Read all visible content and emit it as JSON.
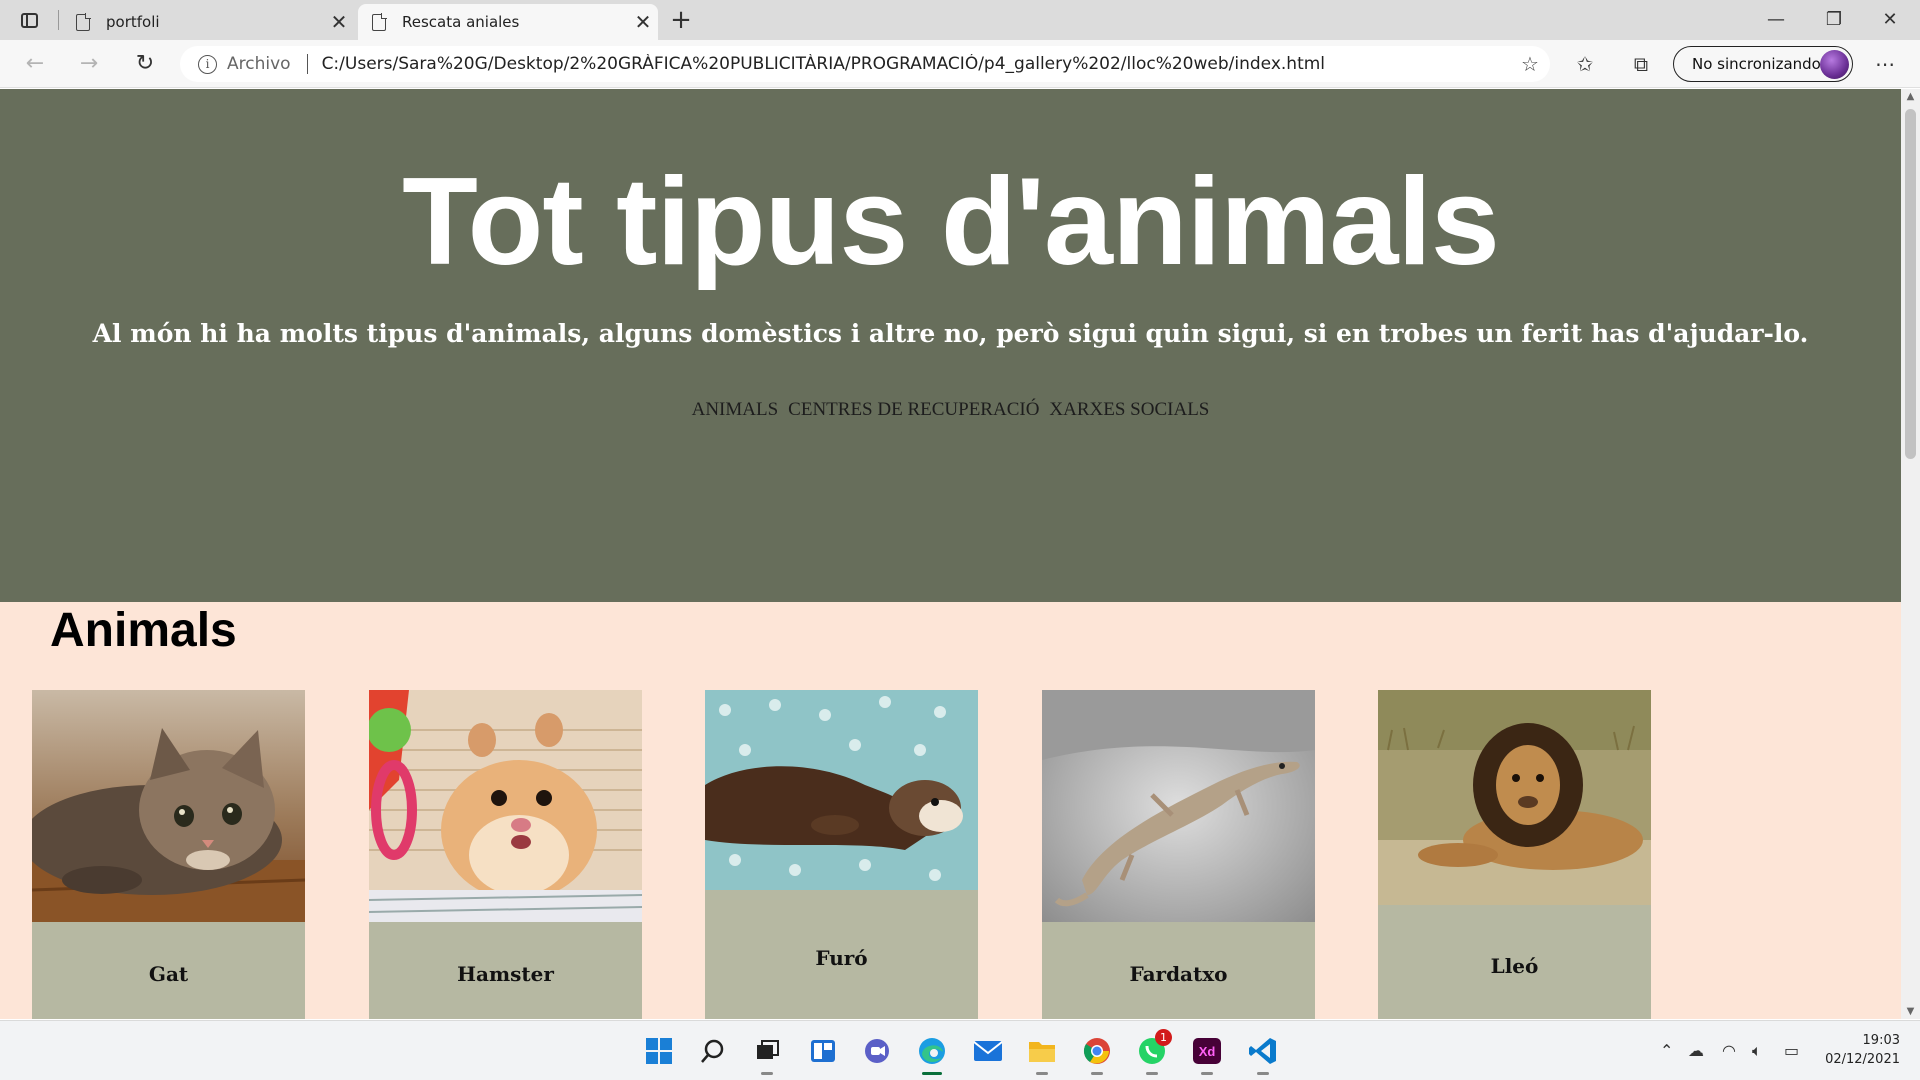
{
  "browser": {
    "tabs": [
      {
        "title": "portfoli",
        "active": false
      },
      {
        "title": "Rescata aniales",
        "active": true
      }
    ],
    "address": {
      "origin_label": "Archivo",
      "url": "C:/Users/Sara%20G/Desktop/2%20GRÀFICA%20PUBLICITÀRIA/PROGRAMACIÓ/p4_gallery%202/lloc%20web/index.html"
    },
    "sync_label": "No sincronizando"
  },
  "hero": {
    "title": "Tot tipus d'animals",
    "subtitle": "Al món hi ha molts tipus d'animals, alguns domèstics i altre no, però sigui quin sigui, si en trobes un ferit has d'ajudar-lo.",
    "nav": [
      "ANIMALS",
      "CENTRES DE RECUPERACIÓ",
      "XARXES SOCIALS"
    ]
  },
  "section": {
    "title": "Animals"
  },
  "cards": [
    {
      "label": "Gat",
      "image": "cat-photo"
    },
    {
      "label": "Hamster",
      "image": "hamster-photo"
    },
    {
      "label": "Furó",
      "image": "ferret-photo"
    },
    {
      "label": "Fardatxo",
      "image": "lizard-photo"
    },
    {
      "label": "Lleó",
      "image": "lion-photo"
    }
  ],
  "taskbar": {
    "apps": [
      "windows-start",
      "search",
      "task-view",
      "widgets",
      "teams-chat",
      "edge",
      "mail",
      "file-explorer",
      "chrome",
      "whatsapp",
      "adobe-xd",
      "vscode"
    ],
    "whatsapp_badge": "1",
    "time": "19:03",
    "date": "02/12/2021"
  },
  "colors": {
    "hero_bg": "#676e5b",
    "page_bg": "#fde5d7",
    "card_bg": "#b6b8a2"
  }
}
